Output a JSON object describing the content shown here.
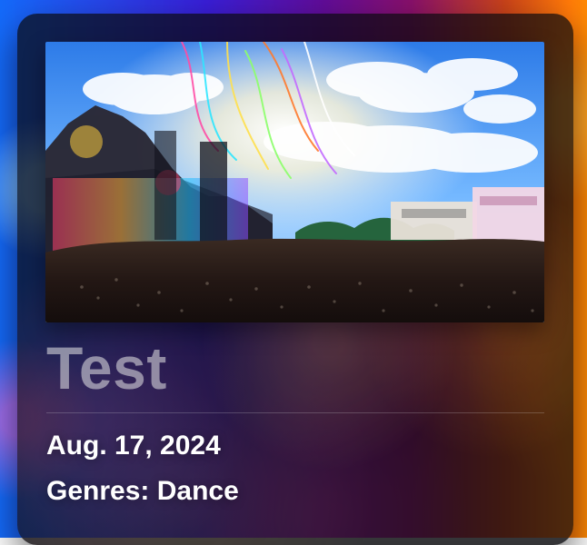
{
  "card": {
    "title": "Test",
    "date": "Aug. 17, 2024",
    "genres_label": "Genres:",
    "genres_value": "Dance"
  }
}
